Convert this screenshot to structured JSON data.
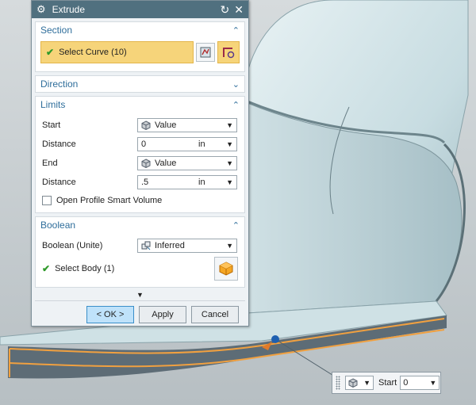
{
  "dialog": {
    "title": "Extrude",
    "section": {
      "header": "Section",
      "select_curve_label": "Select Curve (10)"
    },
    "direction": {
      "header": "Direction"
    },
    "limits": {
      "header": "Limits",
      "start_label": "Start",
      "start_value": "Value",
      "start_distance_label": "Distance",
      "start_distance_value": "0",
      "start_distance_unit": "in",
      "end_label": "End",
      "end_value": "Value",
      "end_distance_label": "Distance",
      "end_distance_value": ".5",
      "end_distance_unit": "in",
      "open_profile_label": "Open Profile Smart Volume"
    },
    "boolean": {
      "header": "Boolean",
      "boolean_label": "Boolean (Unite)",
      "boolean_value": "Inferred",
      "select_body_label": "Select Body (1)"
    },
    "buttons": {
      "ok": "< OK >",
      "apply": "Apply",
      "cancel": "Cancel"
    }
  },
  "floating_widget": {
    "start_label": "Start",
    "start_value": "0"
  },
  "colors": {
    "titlebar": "#50707f",
    "group_header_text": "#2f6e9b",
    "selection_highlight": "#f6d47a",
    "model_shell": "#d5e6ea",
    "model_wall": "#5d6c76",
    "edge_highlight": "#f0a040",
    "ok_button": "#bfe2fa",
    "check": "#2f9a2a"
  },
  "icons": {
    "title": "gear-icon",
    "reset": "reset-icon",
    "close": "close-icon",
    "collapse": "chevron-up-icon",
    "expand": "chevron-down-icon",
    "curve_rule": "curve-rule-icon",
    "sketch": "sketch-section-icon",
    "value_cube": "cube-icon",
    "boolean": "unite-icon",
    "select_body": "solid-body-icon",
    "more": "more-options-icon"
  }
}
